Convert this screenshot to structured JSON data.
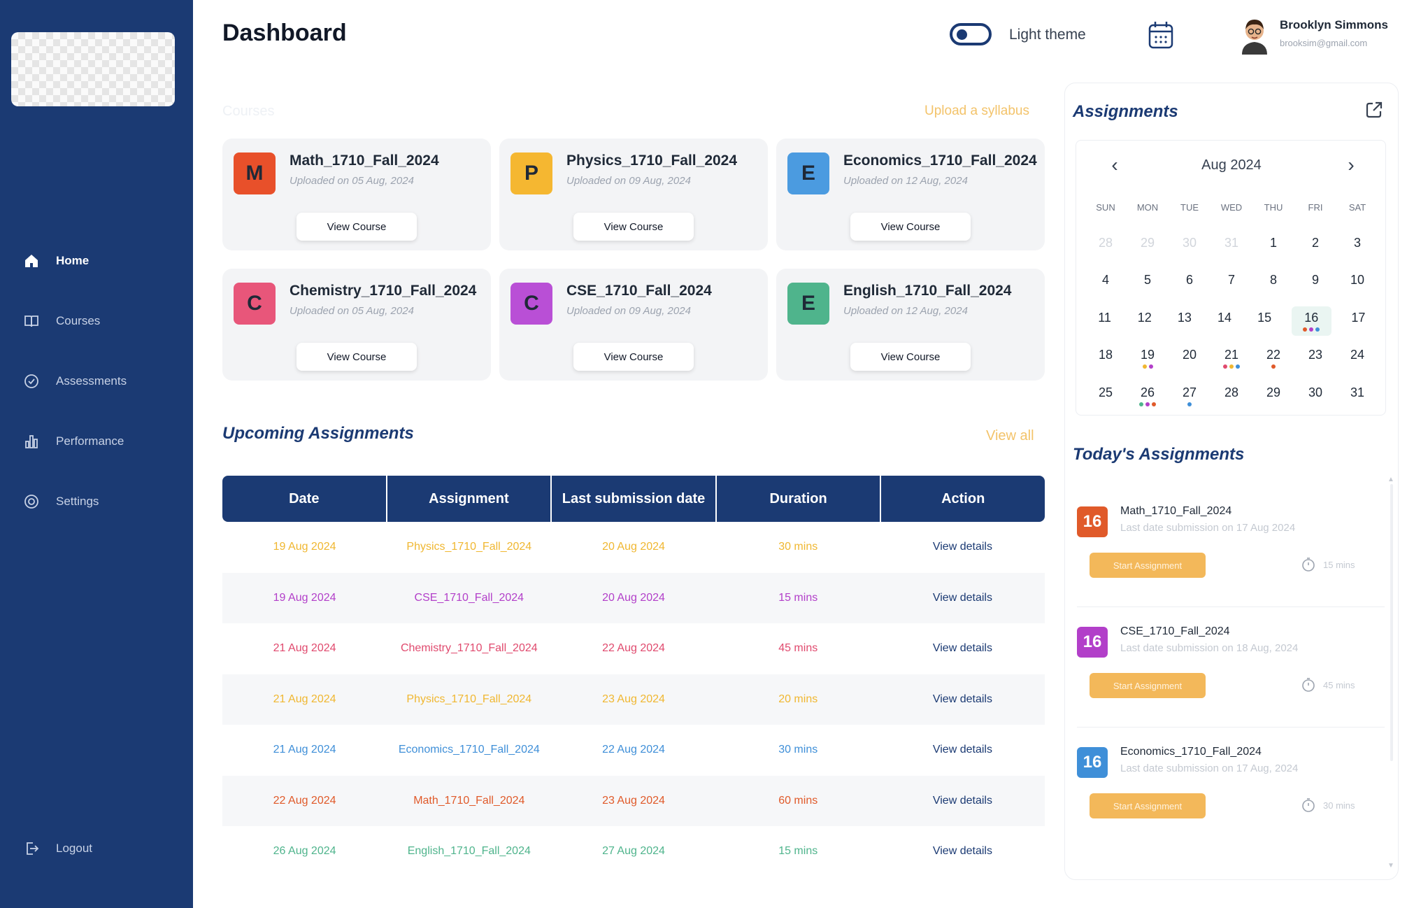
{
  "sidebar": {
    "items": [
      {
        "label": "Home",
        "icon": "home-icon"
      },
      {
        "label": "Courses",
        "icon": "book-icon"
      },
      {
        "label": "Assessments",
        "icon": "assessment-icon"
      },
      {
        "label": "Performance",
        "icon": "bar-chart-icon"
      },
      {
        "label": "Settings",
        "icon": "gear-icon"
      }
    ],
    "logout_label": "Logout"
  },
  "header": {
    "title": "Dashboard",
    "theme_label": "Light theme",
    "user_name": "Brooklyn Simmons",
    "user_email": "brooksim@gmail.com"
  },
  "courses": {
    "section_label": "Courses",
    "upload_label": "Upload a syllabus",
    "view_label": "View Course",
    "items": [
      {
        "letter": "M",
        "name": "Math_1710_Fall_2024",
        "uploaded": "Uploaded on 05 Aug, 2024",
        "color": "#e8502a"
      },
      {
        "letter": "P",
        "name": "Physics_1710_Fall_2024",
        "uploaded": "Uploaded on 09 Aug, 2024",
        "color": "#f5b731"
      },
      {
        "letter": "E",
        "name": "Economics_1710_Fall_2024",
        "uploaded": "Uploaded on 12 Aug, 2024",
        "color": "#4b9be0"
      },
      {
        "letter": "C",
        "name": "Chemistry_1710_Fall_2024",
        "uploaded": "Uploaded on 05 Aug, 2024",
        "color": "#e8567a"
      },
      {
        "letter": "C",
        "name": "CSE_1710_Fall_2024",
        "uploaded": "Uploaded on 09 Aug, 2024",
        "color": "#b94fd6"
      },
      {
        "letter": "E",
        "name": "English_1710_Fall_2024",
        "uploaded": "Uploaded on 12 Aug, 2024",
        "color": "#4fb48c"
      }
    ]
  },
  "upcoming": {
    "title": "Upcoming Assignments",
    "view_all": "View all",
    "columns": [
      "Date",
      "Assignment",
      "Last submission date",
      "Duration",
      "Action"
    ],
    "rows": [
      {
        "date": "19 Aug 2024",
        "assignment": "Physics_1710_Fall_2024",
        "last": "20 Aug 2024",
        "duration": "30 mins",
        "action": "View details",
        "color": "#f0b731"
      },
      {
        "date": "19 Aug 2024",
        "assignment": "CSE_1710_Fall_2024",
        "last": "20 Aug 2024",
        "duration": "15 mins",
        "action": "View details",
        "color": "#b23fc9"
      },
      {
        "date": "21 Aug 2024",
        "assignment": "Chemistry_1710_Fall_2024",
        "last": "22 Aug 2024",
        "duration": "45 mins",
        "action": "View details",
        "color": "#e04a6e"
      },
      {
        "date": "21 Aug 2024",
        "assignment": "Physics_1710_Fall_2024",
        "last": "23 Aug 2024",
        "duration": "20 mins",
        "action": "View details",
        "color": "#f0b731"
      },
      {
        "date": "21 Aug 2024",
        "assignment": "Economics_1710_Fall_2024",
        "last": "22 Aug 2024",
        "duration": "30 mins",
        "action": "View details",
        "color": "#3f8fd8"
      },
      {
        "date": "22 Aug 2024",
        "assignment": "Math_1710_Fall_2024",
        "last": "23 Aug 2024",
        "duration": "60 mins",
        "action": "View details",
        "color": "#e05a2a"
      },
      {
        "date": "26 Aug 2024",
        "assignment": "English_1710_Fall_2024",
        "last": "27 Aug 2024",
        "duration": "15 mins",
        "action": "View details",
        "color": "#4fb48c"
      }
    ]
  },
  "assignments_panel": {
    "title": "Assignments",
    "month": "Aug 2024",
    "weekdays": [
      "SUN",
      "MON",
      "TUE",
      "WED",
      "THU",
      "FRI",
      "SAT"
    ],
    "weeks": [
      [
        {
          "d": "28",
          "m": true
        },
        {
          "d": "29",
          "m": true
        },
        {
          "d": "30",
          "m": true
        },
        {
          "d": "31",
          "m": true
        },
        {
          "d": "1"
        },
        {
          "d": "2"
        },
        {
          "d": "3"
        }
      ],
      [
        {
          "d": "4"
        },
        {
          "d": "5"
        },
        {
          "d": "6"
        },
        {
          "d": "7"
        },
        {
          "d": "8"
        },
        {
          "d": "9"
        },
        {
          "d": "10"
        }
      ],
      [
        {
          "d": "11"
        },
        {
          "d": "12"
        },
        {
          "d": "13"
        },
        {
          "d": "14"
        },
        {
          "d": "15"
        },
        {
          "d": "16",
          "today": true,
          "dots": [
            "#e05a2a",
            "#b23fc9",
            "#3f8fd8"
          ]
        },
        {
          "d": "17"
        }
      ],
      [
        {
          "d": "18"
        },
        {
          "d": "19",
          "dots": [
            "#f0b731",
            "#b23fc9"
          ]
        },
        {
          "d": "20"
        },
        {
          "d": "21",
          "dots": [
            "#e04a6e",
            "#f0b731",
            "#3f8fd8"
          ]
        },
        {
          "d": "22",
          "dots": [
            "#e05a2a"
          ]
        },
        {
          "d": "23"
        },
        {
          "d": "24"
        }
      ],
      [
        {
          "d": "25"
        },
        {
          "d": "26",
          "dots": [
            "#4fb48c",
            "#b23fc9",
            "#e05a2a"
          ]
        },
        {
          "d": "27",
          "dots": [
            "#3f8fd8"
          ]
        },
        {
          "d": "28"
        },
        {
          "d": "29"
        },
        {
          "d": "30"
        },
        {
          "d": "31"
        }
      ]
    ],
    "today_title": "Today's Assignments",
    "start_label": "Start Assignment",
    "today_items": [
      {
        "day": "16",
        "name": "Math_1710_Fall_2024",
        "sub": "Last date submission on 17 Aug 2024",
        "duration": "15 mins",
        "color": "#e05a2a"
      },
      {
        "day": "16",
        "name": "CSE_1710_Fall_2024",
        "sub": "Last date submission on 18 Aug, 2024",
        "duration": "45 mins",
        "color": "#b23fc9"
      },
      {
        "day": "16",
        "name": "Economics_1710_Fall_2024",
        "sub": "Last date submission on 17 Aug, 2024",
        "duration": "30 mins",
        "color": "#3f8fd8"
      }
    ]
  }
}
